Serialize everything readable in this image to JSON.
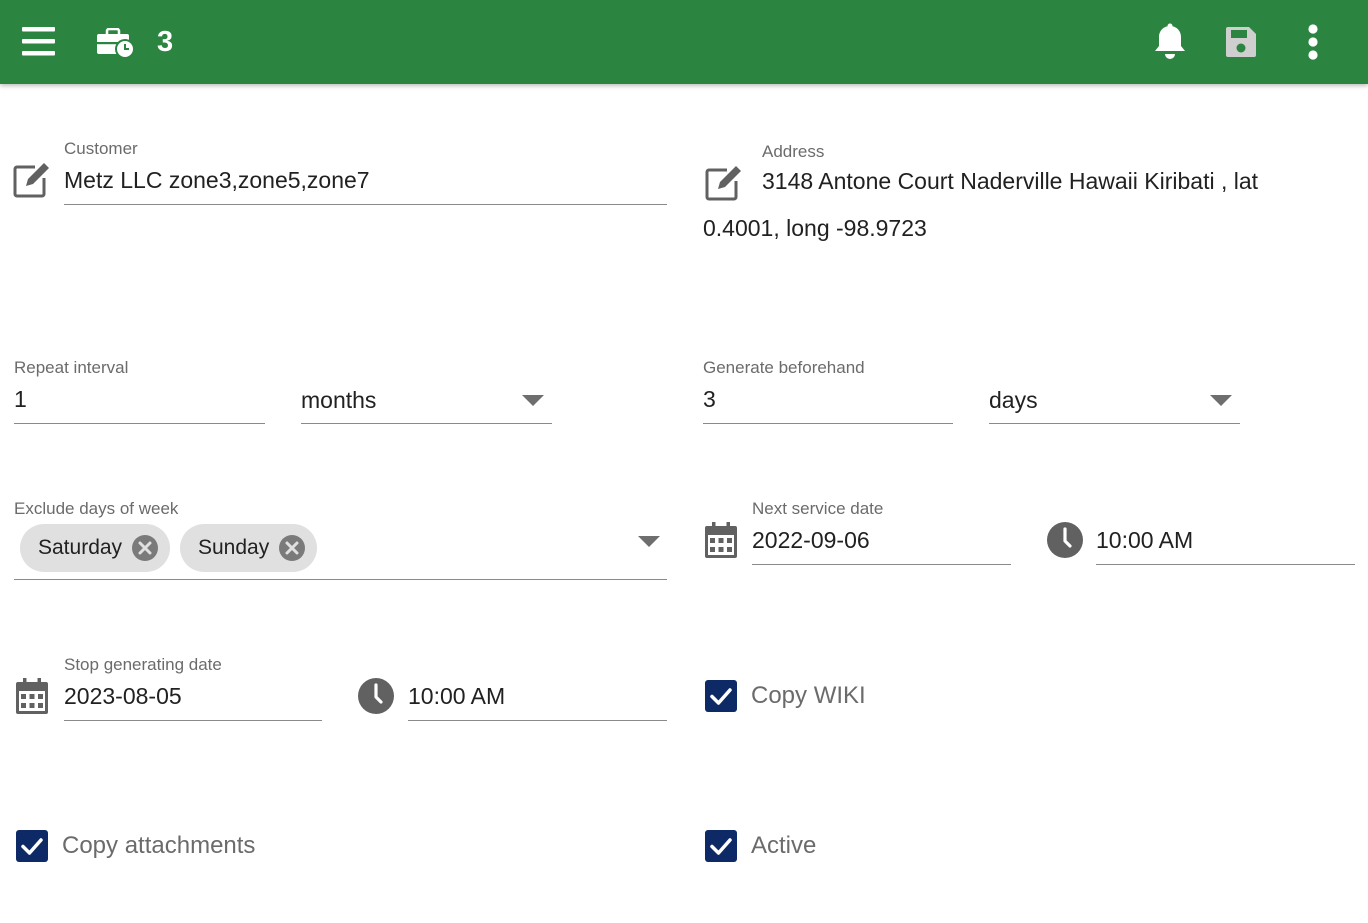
{
  "appbar": {
    "job_count": "3",
    "icons": [
      "menu-icon",
      "briefcase-clock-icon",
      "bell-icon",
      "save-icon",
      "more-vert-icon"
    ]
  },
  "colors": {
    "appbar": "#2b8540",
    "checkbox": "#0d2a66",
    "chip": "#e0e0e0",
    "label": "#6b6b6b"
  },
  "customer": {
    "label": "Customer",
    "value": "Metz LLC zone3,zone5,zone7"
  },
  "address": {
    "label": "Address",
    "line1": "3148 Antone Court Naderville Hawaii Kiribati , lat",
    "line2": "0.4001, long -98.9723"
  },
  "repeat": {
    "label": "Repeat interval",
    "value": "1",
    "unit": "months"
  },
  "generate": {
    "label": "Generate beforehand",
    "value": "3",
    "unit": "days"
  },
  "exclude": {
    "label": "Exclude days of week",
    "chips": [
      "Saturday",
      "Sunday"
    ]
  },
  "next_service": {
    "label": "Next service date",
    "date": "2022-09-06",
    "time": "10:00 AM"
  },
  "stop": {
    "label": "Stop generating date",
    "date": "2023-08-05",
    "time": "10:00 AM"
  },
  "checkboxes": {
    "copy_wiki": {
      "label": "Copy WIKI",
      "checked": true
    },
    "copy_attachments": {
      "label": "Copy attachments",
      "checked": true
    },
    "active": {
      "label": "Active",
      "checked": true
    }
  }
}
